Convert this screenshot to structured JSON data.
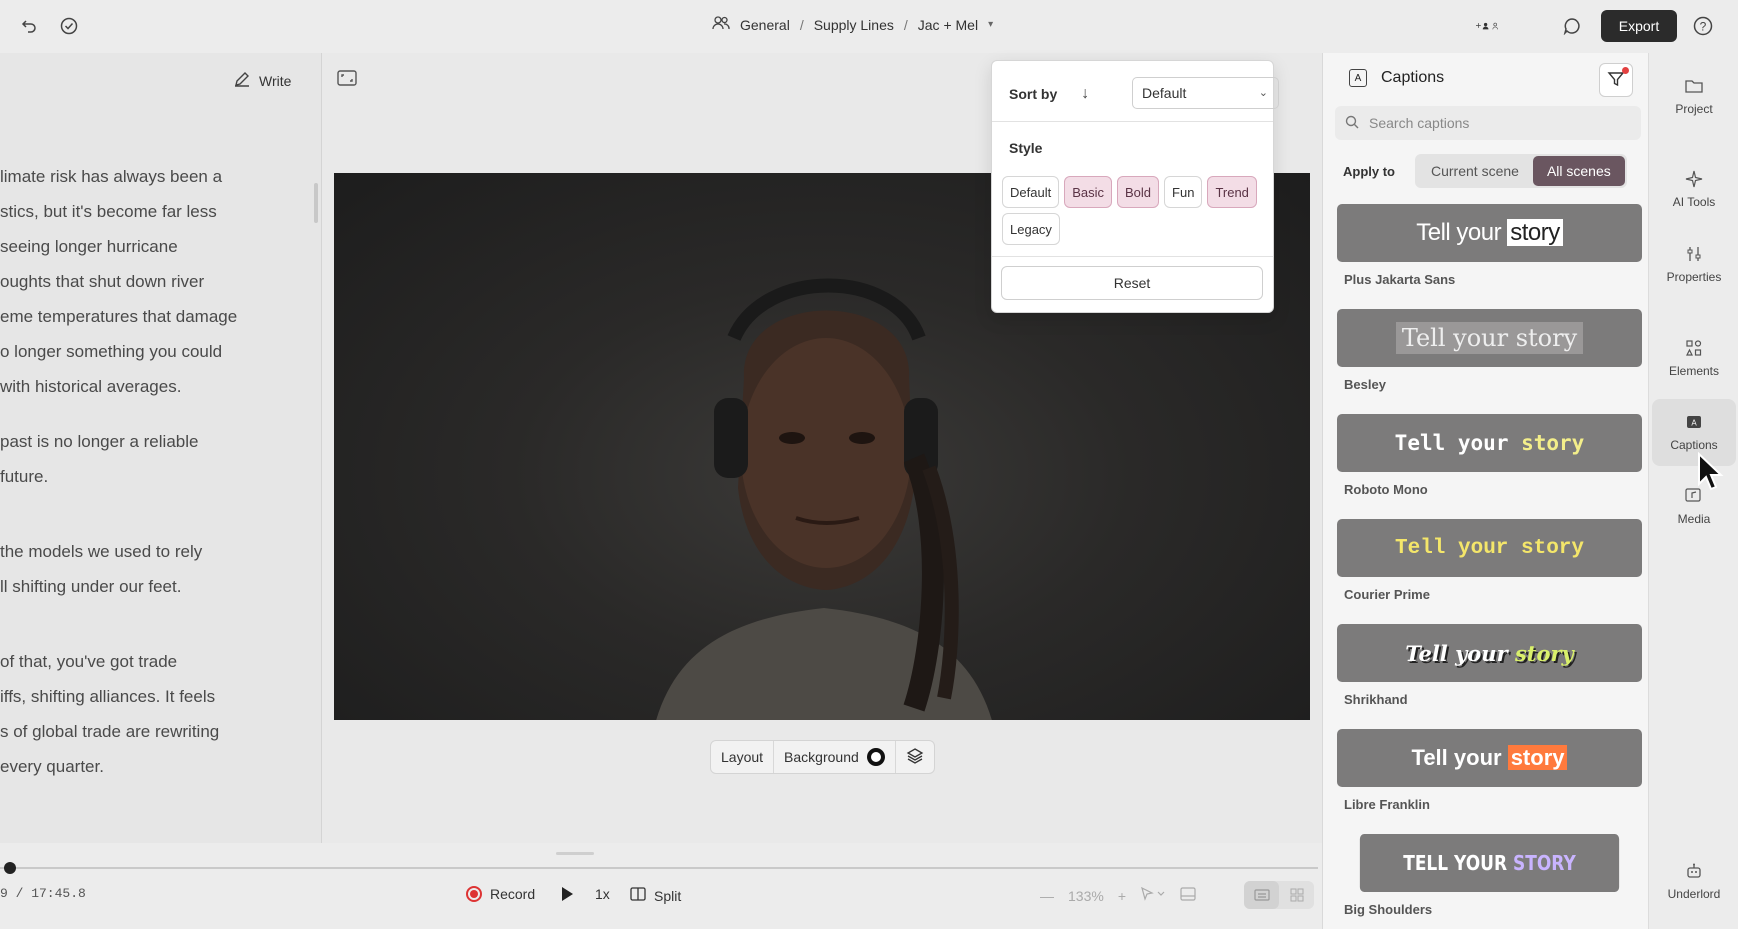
{
  "topbar": {
    "breadcrumb": [
      "General",
      "Supply Lines",
      "Jac + Mel"
    ],
    "export_label": "Export"
  },
  "script": {
    "write_label": "Write",
    "paragraphs": [
      [
        "limate risk has always been a",
        "stics, but it's become far less",
        "seeing longer hurricane",
        "oughts that shut down river",
        "eme temperatures that damage",
        "o longer something you could",
        "with historical averages."
      ],
      [
        "past is no longer a reliable",
        "future."
      ],
      [
        " the models we used to rely",
        "ll shifting under our feet."
      ],
      [
        "of that, you've got trade",
        "iffs, shifting alliances. It feels",
        "s of global trade are rewriting",
        "every quarter."
      ]
    ]
  },
  "canvas": {
    "layout_label": "Layout",
    "background_label": "Background"
  },
  "timeline": {
    "timecode": "9  /  17:45.8",
    "record_label": "Record",
    "speed_label": "1x",
    "split_label": "Split",
    "zoom_label": "133%"
  },
  "sort_popover": {
    "sort_by_label": "Sort by",
    "sort_value": "Default",
    "style_label": "Style",
    "chips": [
      {
        "label": "Default",
        "selected": false
      },
      {
        "label": "Basic",
        "selected": true
      },
      {
        "label": "Bold",
        "selected": true
      },
      {
        "label": "Fun",
        "selected": false
      },
      {
        "label": "Trend",
        "selected": true
      },
      {
        "label": "Legacy",
        "selected": false
      }
    ],
    "reset_label": "Reset"
  },
  "captions": {
    "title": "Captions",
    "search_placeholder": "Search captions",
    "apply_to_label": "Apply to",
    "apply_options": [
      "Current scene",
      "All scenes"
    ],
    "apply_selected": "All scenes",
    "preview_text": "Tell your story",
    "styles": [
      {
        "name": "Plus Jakarta Sans"
      },
      {
        "name": "Besley"
      },
      {
        "name": "Roboto Mono"
      },
      {
        "name": "Courier Prime"
      },
      {
        "name": "Shrikhand"
      },
      {
        "name": "Libre Franklin"
      },
      {
        "name": "Big Shoulders"
      }
    ],
    "big_shoulders_preview": "TELL YOUR STORY"
  },
  "rail": {
    "items": [
      "Project",
      "AI Tools",
      "Properties",
      "Elements",
      "Captions",
      "Media",
      "Underlord"
    ],
    "active": "Captions"
  },
  "colors": {
    "accent": "#6a5660",
    "chip_selected_bg": "#f3dde6",
    "export_bg": "#2b2b2b"
  }
}
